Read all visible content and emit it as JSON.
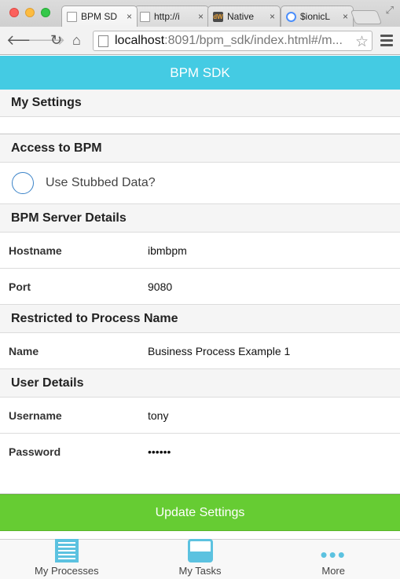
{
  "browser": {
    "tabs": [
      {
        "label": "BPM SD",
        "icon": "document-icon",
        "active": true
      },
      {
        "label": "http://i",
        "icon": "document-icon",
        "active": false
      },
      {
        "label": "Native",
        "icon": "dw-icon",
        "active": false
      },
      {
        "label": "$ionicL",
        "icon": "ionic-icon",
        "active": false
      }
    ],
    "tab_close": "×",
    "url_host": "localhost",
    "url_rest": ":8091/bpm_sdk/index.html#/m..."
  },
  "app": {
    "title": "BPM SDK",
    "accent_color": "#44cbe3",
    "button_color": "#66cc33"
  },
  "settings": {
    "my_settings": "My Settings",
    "access_header": "Access to BPM",
    "use_stubbed": "Use Stubbed Data?",
    "server_header": "BPM Server Details",
    "hostname_label": "Hostname",
    "hostname_value": "ibmbpm",
    "port_label": "Port",
    "port_value": "9080",
    "process_header": "Restricted to Process Name",
    "name_label": "Name",
    "name_value": "Business Process Example 1",
    "user_header": "User Details",
    "username_label": "Username",
    "username_value": "tony",
    "password_label": "Password",
    "password_value": "••••••",
    "update_button": "Update Settings"
  },
  "bottom_tabs": [
    {
      "label": "My Processes",
      "icon": "processes-icon"
    },
    {
      "label": "My Tasks",
      "icon": "inbox-icon"
    },
    {
      "label": "More",
      "icon": "more-icon"
    }
  ]
}
